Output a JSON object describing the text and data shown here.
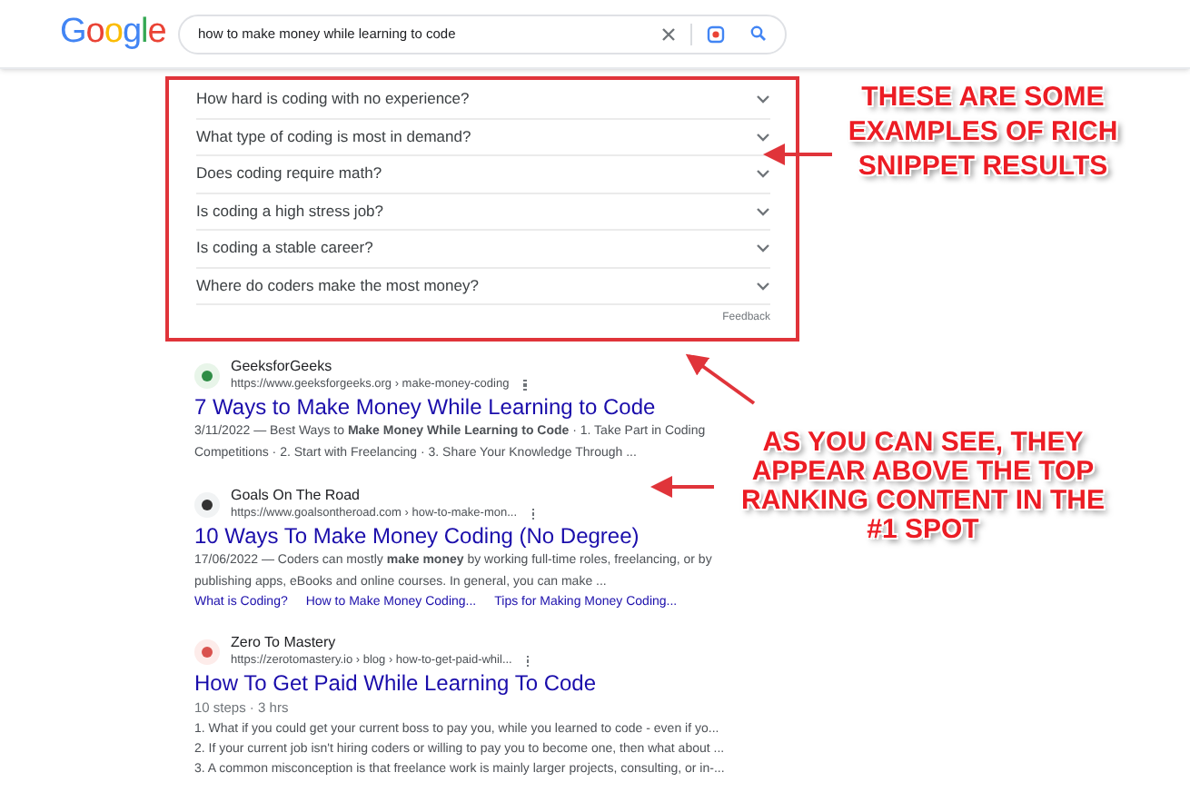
{
  "header": {
    "logo": "Google",
    "search": {
      "value": "how to make money while learning to code"
    }
  },
  "faq": {
    "questions": [
      {
        "text": "How hard is coding with no experience?",
        "expanded": false
      },
      {
        "text": "What type of coding is most in demand?",
        "expanded": false
      },
      {
        "text": "Does coding require math?",
        "expanded": false
      },
      {
        "text": "Is coding a high stress job?",
        "expanded": false
      },
      {
        "text": "Is coding a stable career?",
        "expanded": false
      },
      {
        "text": "Where do coders make the most money?",
        "expanded": false
      }
    ],
    "feedback": "Feedback"
  },
  "results": [
    {
      "kind": "snippet",
      "site": "GeeksforGeeks",
      "url": "https://www.geeksforgeeks.org › make-money-coding",
      "title": "7 Ways to Make Money While Learning to Code",
      "lines": [
        "3/11/2022 — Best Ways to **Make Money While Learning to Code** · 1. Take Part in Coding",
        "Competitions · 2. Start with Freelancing · 3. Share Your Knowledge Through ..."
      ]
    },
    {
      "kind": "snippet",
      "site": "Goals On The Road",
      "url": "https://www.goalsontheroad.com › how-to-make-mon...",
      "title": "10 Ways To Make Money Coding (No Degree)",
      "lines": [
        "17/06/2022 — Coders can mostly **make money** by working full-time roles, freelancing, or by",
        "publishing apps, eBooks and online courses. In general, you can make ..."
      ],
      "sitelinks": [
        "What is Coding?",
        "How to Make Money Coding...",
        "Tips for Making Money Coding..."
      ]
    },
    {
      "kind": "steps",
      "site": "Zero To Mastery",
      "url": "https://zerotomastery.io › blog › how-to-get-paid-whil...",
      "title": "How To Get Paid While Learning To Code",
      "meta": "10 steps · 3 hrs",
      "lines": [
        "1. What if you could get your current boss to pay you, while you learned to code - even if yo...",
        "2. If your current job isn't hiring coders or willing to pay you to become one, then what about ...",
        "3. A common misconception is that freelance work is mainly larger projects, consulting, or in-..."
      ]
    }
  ],
  "annotations": [
    "THESE ARE SOME EXAMPLES OF RICH SNIPPET RESULTS",
    "AS YOU CAN SEE, THEY APPEAR ABOVE THE TOP RANKING CONTENT IN THE #1 SPOT"
  ]
}
